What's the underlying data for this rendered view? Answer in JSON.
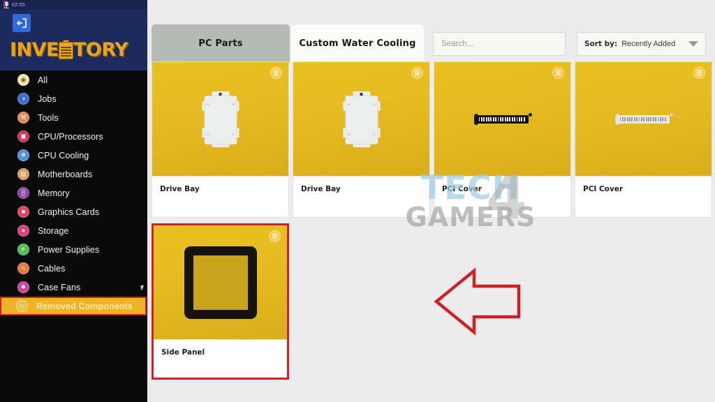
{
  "statusbar": {
    "timer": "02:05",
    "mic_icon": "microphone-recording-icon"
  },
  "sidebar": {
    "exit_icon": "exit-logout-icon",
    "logo": {
      "part1": "INVE",
      "part2": "TORY",
      "clipboard_icon": "clipboard-icon"
    },
    "items": [
      {
        "label": "All",
        "icon": "all-circle-icon",
        "color": "#f3e3b4",
        "glyph": "◉",
        "active": false
      },
      {
        "label": "Jobs",
        "icon": "jobs-icon",
        "color": "#3b6fd4",
        "glyph": "◑",
        "active": false
      },
      {
        "label": "Tools",
        "icon": "tools-icon",
        "color": "#e08a52",
        "glyph": "⚒",
        "active": false
      },
      {
        "label": "CPU/Processors",
        "icon": "cpu-chip-icon",
        "color": "#d32f5e",
        "glyph": "▣",
        "active": false
      },
      {
        "label": "CPU Cooling",
        "icon": "snowflake-icon",
        "color": "#4f93d6",
        "glyph": "❄",
        "active": false
      },
      {
        "label": "Motherboards",
        "icon": "motherboard-icon",
        "color": "#e09a5a",
        "glyph": "▤",
        "active": false
      },
      {
        "label": "Memory",
        "icon": "memory-ram-icon",
        "color": "#8b3fa8",
        "glyph": "░",
        "active": false
      },
      {
        "label": "Graphics Cards",
        "icon": "graphics-card-icon",
        "color": "#e0435f",
        "glyph": "■",
        "active": false
      },
      {
        "label": "Storage",
        "icon": "storage-drive-icon",
        "color": "#d8427f",
        "glyph": "●",
        "active": false
      },
      {
        "label": "Power Supplies",
        "icon": "power-bolt-icon",
        "color": "#3fc06a",
        "glyph": "⚡",
        "active": false
      },
      {
        "label": "Cables",
        "icon": "cable-icon",
        "color": "#e07b3c",
        "glyph": "∿",
        "active": false
      },
      {
        "label": "Case Fans",
        "icon": "case-fan-icon",
        "color": "#d43fa0",
        "glyph": "✸",
        "active": false
      },
      {
        "label": "Removed Components",
        "icon": "removed-trash-icon",
        "color": "#e8c14e",
        "glyph": "▭",
        "active": true
      }
    ]
  },
  "topbar": {
    "tabs": [
      {
        "label": "PC Parts",
        "selected": true
      },
      {
        "label": "Custom Water Cooling",
        "selected": false
      }
    ],
    "search": {
      "placeholder": "Search...",
      "value": ""
    },
    "sort": {
      "label": "Sort by:",
      "value": "Recently Added",
      "caret_icon": "chevron-down-icon"
    }
  },
  "grid": {
    "row1": [
      {
        "name": "Drive Bay",
        "art": "drivebay",
        "badge_icon": "trash-icon",
        "highlighted": false
      },
      {
        "name": "Drive Bay",
        "art": "drivebay",
        "badge_icon": "trash-icon",
        "highlighted": false
      },
      {
        "name": "PCI Cover",
        "art": "pcicover",
        "badge_icon": "trash-icon",
        "highlighted": false
      },
      {
        "name": "PCI Cover",
        "art": "pcicover",
        "badge_icon": "trash-icon",
        "highlighted": false
      }
    ],
    "row2": [
      {
        "name": "Side Panel",
        "art": "sidepanel",
        "badge_icon": "trash-icon",
        "highlighted": true
      }
    ]
  },
  "annotations": {
    "arrow": {
      "icon": "left-arrow-annotation",
      "color": "#cf2026",
      "direction": "left"
    },
    "highlight_color": "#cf2026"
  },
  "watermark": {
    "line1": "TECH",
    "line2": "GAMERS",
    "big": "4"
  },
  "colors": {
    "accent_gold": "#e8a41e",
    "card_yellow": "#e5bb20",
    "sidebar_bg": "#0a0a0a",
    "header_blue": "#1c2a5e",
    "highlight_red": "#cf2026",
    "active_item_bg": "#f0b323"
  }
}
